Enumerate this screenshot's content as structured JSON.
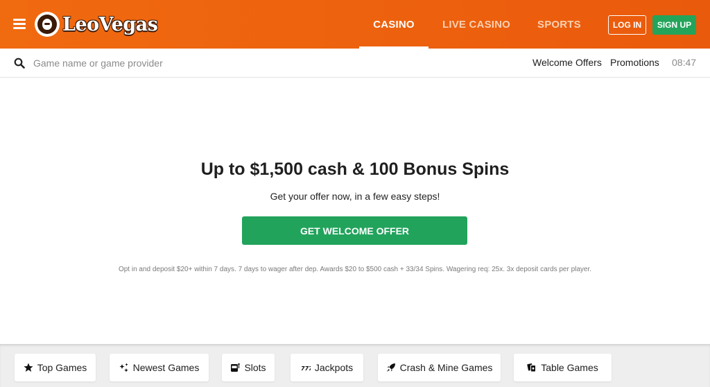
{
  "header": {
    "menu_icon": "hamburger-icon",
    "logo_text": "LeoVegas",
    "logo_icon": "lion-icon",
    "tabs": [
      {
        "label": "CASINO",
        "active": true
      },
      {
        "label": "LIVE CASINO",
        "active": false
      },
      {
        "label": "SPORTS",
        "active": false
      }
    ],
    "login_label": "LOG IN",
    "signup_label": "SIGN UP",
    "brand_color": "#ea5a0c",
    "signup_color": "#23a45a"
  },
  "subbar": {
    "search_icon": "search-icon",
    "search_placeholder": "Game name or game provider",
    "links": [
      "Welcome Offers",
      "Promotions"
    ],
    "time": "08:47"
  },
  "hero": {
    "title": "Up to $1,500 cash & 100 Bonus Spins",
    "subtitle": "Get your offer now, in a few easy steps!",
    "cta_label": "GET WELCOME OFFER",
    "terms": "Opt in and deposit $20+ within 7 days. 7 days to wager after dep. Awards $20 to $500 cash + 33/34 Spins. Wagering req: 25x. 3x deposit cards per player."
  },
  "categories": [
    {
      "label": "Top Games",
      "icon": "star-icon"
    },
    {
      "label": "Newest Games",
      "icon": "sparkle-icon"
    },
    {
      "label": "Slots",
      "icon": "slot-machine-icon"
    },
    {
      "label": "Jackpots",
      "icon": "jackpot-777-icon"
    },
    {
      "label": "Crash & Mine Games",
      "icon": "rocket-icon"
    },
    {
      "label": "Table Games",
      "icon": "cards-icon"
    }
  ]
}
